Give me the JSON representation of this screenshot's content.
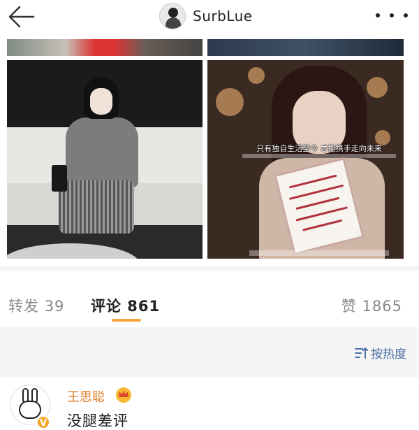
{
  "header": {
    "title": "SurbLue",
    "back_icon": "back-arrow-icon",
    "more_icon": "more-dots-icon"
  },
  "photo_right": {
    "subtitle_text": "只有独自生活至今 才能携手走向未来"
  },
  "tabs": {
    "repost_label": "转发 39",
    "comments_label": "评论 861",
    "likes_label": "赞 1865",
    "active": "评论",
    "accent_color": "#f7a23a"
  },
  "sort": {
    "label": "按热度",
    "icon": "sort-icon",
    "color": "#4a6fa5"
  },
  "comments": [
    {
      "username": "王思聪",
      "badge": "V",
      "text": "没腿差评",
      "name_color": "#e07b26"
    }
  ]
}
